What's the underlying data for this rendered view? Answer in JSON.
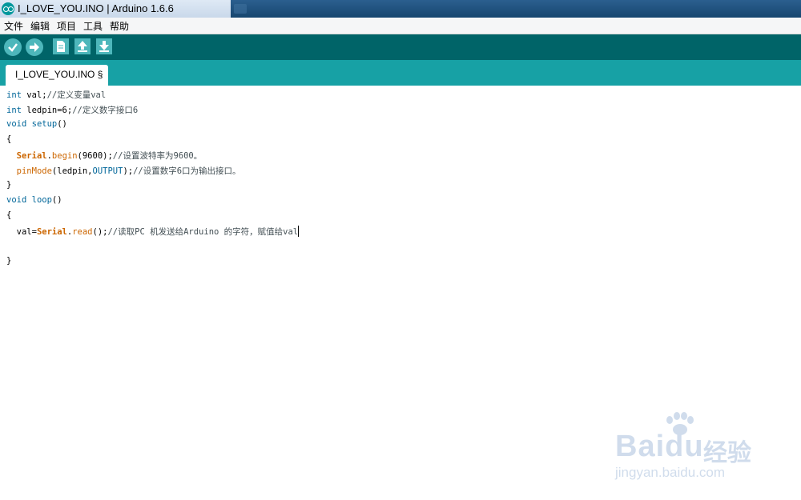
{
  "window": {
    "title": "I_LOVE_YOU.INO | Arduino 1.6.6"
  },
  "menu": [
    "文件",
    "编辑",
    "项目",
    "工具",
    "帮助"
  ],
  "toolbar": {
    "buttons": [
      {
        "name": "verify",
        "icon": "checkmark-icon"
      },
      {
        "name": "upload",
        "icon": "arrow-right-icon"
      },
      {
        "name": "new",
        "icon": "document-icon"
      },
      {
        "name": "open",
        "icon": "arrow-up-icon"
      },
      {
        "name": "save",
        "icon": "arrow-down-icon"
      }
    ]
  },
  "tabs": [
    {
      "label": "I_LOVE_YOU.INO §",
      "active": true
    }
  ],
  "code": {
    "l1_kw": "int",
    "l1_rest": " val;",
    "l1_cm": "//定义变量val",
    "l2_kw": "int",
    "l2_rest": " ledpin=6;",
    "l2_cm": "//定义数字接口6",
    "l3_kw": "void",
    "l3_fn": " setup",
    "l3_rest": "()",
    "l4": "{",
    "l5_obj": "Serial",
    "l5_dot": ".",
    "l5_fn": "begin",
    "l5_rest": "(9600);",
    "l5_cm": "//设置波特率为9600。",
    "l6_fn": "pinMode",
    "l6_rest1": "(ledpin,",
    "l6_const": "OUTPUT",
    "l6_rest2": ");",
    "l6_cm": "//设置数字6口为输出接口。",
    "l7": "}",
    "l8_kw": "void",
    "l8_fn": " loop",
    "l8_rest": "()",
    "l9": "{",
    "l10_pre": "val=",
    "l10_obj": "Serial",
    "l10_dot": ".",
    "l10_fn": "read",
    "l10_rest": "();",
    "l10_cm": "//读取PC 机发送给Arduino 的字符，赋值给val",
    "l11": "",
    "l12": "}"
  },
  "watermark": {
    "brand": "Baidu",
    "brand_cn": "经验",
    "url": "jingyan.baidu.com"
  },
  "colors": {
    "toolbar": "#006468",
    "tabbar": "#17a1a5",
    "button": "#4db7bb",
    "keyword": "#006699",
    "function": "#cc6600"
  }
}
